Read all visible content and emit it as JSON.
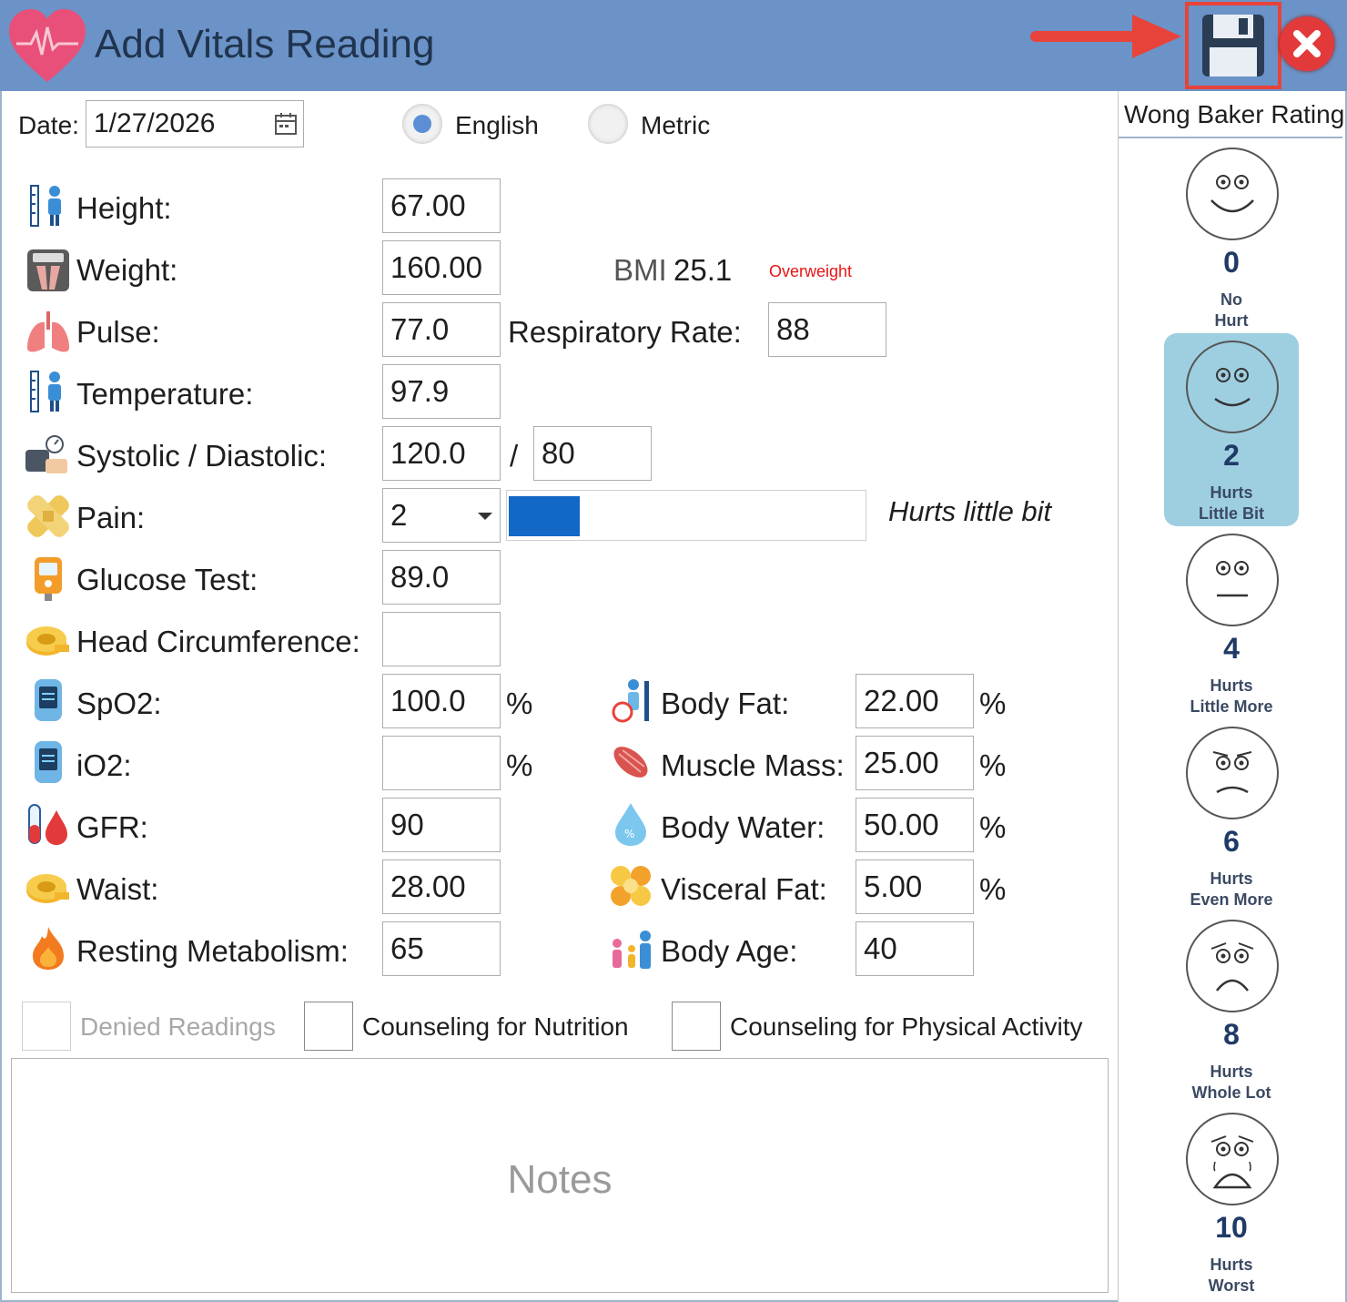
{
  "window": {
    "title": "Add Vitals Reading"
  },
  "date": {
    "label": "Date:",
    "value": "1/27/2026"
  },
  "units": {
    "english_label": "English",
    "metric_label": "Metric",
    "selected": "English"
  },
  "vitals": {
    "height": {
      "label": "Height:",
      "value": "67.00"
    },
    "weight": {
      "label": "Weight:",
      "value": "160.00"
    },
    "bmi": {
      "label": "BMI",
      "value": "25.1",
      "status": "Overweight",
      "status_color": "#e81515"
    },
    "pulse": {
      "label": "Pulse:",
      "value": "77.0"
    },
    "respiratory_rate": {
      "label": "Respiratory Rate:",
      "value": "88"
    },
    "temperature": {
      "label": "Temperature:",
      "value": "97.9"
    },
    "blood_pressure": {
      "label": "Systolic / Diastolic:",
      "systolic": "120.0",
      "separator": "/",
      "diastolic": "80"
    },
    "pain": {
      "label": "Pain:",
      "value": "2",
      "max": 10,
      "description": "Hurts little bit",
      "bar_color": "#1168c6"
    },
    "glucose": {
      "label": "Glucose Test:",
      "value": "89.0"
    },
    "head_circumference": {
      "label": "Head Circumference:",
      "value": ""
    },
    "spo2": {
      "label": "SpO2:",
      "value": "100.0",
      "unit": "%"
    },
    "io2": {
      "label": "iO2:",
      "value": "",
      "unit": "%"
    },
    "gfr": {
      "label": "GFR:",
      "value": "90"
    },
    "waist": {
      "label": "Waist:",
      "value": "28.00"
    },
    "resting_metabolism": {
      "label": "Resting Metabolism:",
      "value": "65"
    },
    "body_fat": {
      "label": "Body Fat:",
      "value": "22.00",
      "unit": "%"
    },
    "muscle_mass": {
      "label": "Muscle Mass:",
      "value": "25.00",
      "unit": "%"
    },
    "body_water": {
      "label": "Body Water:",
      "value": "50.00",
      "unit": "%"
    },
    "visceral_fat": {
      "label": "Visceral Fat:",
      "value": "5.00",
      "unit": "%"
    },
    "body_age": {
      "label": "Body Age:",
      "value": "40"
    }
  },
  "checkboxes": {
    "denied_readings": "Denied Readings",
    "counseling_nutrition": "Counseling for Nutrition",
    "counseling_activity": "Counseling for Physical Activity"
  },
  "notes": {
    "placeholder": "Notes"
  },
  "wong_baker": {
    "title": "Wong Baker Rating",
    "selected": "2",
    "faces": [
      {
        "num": "0",
        "desc": "No\nHurt"
      },
      {
        "num": "2",
        "desc": "Hurts\nLittle Bit"
      },
      {
        "num": "4",
        "desc": "Hurts\nLittle More"
      },
      {
        "num": "6",
        "desc": "Hurts\nEven More"
      },
      {
        "num": "8",
        "desc": "Hurts\nWhole Lot"
      },
      {
        "num": "10",
        "desc": "Hurts\nWorst"
      }
    ]
  },
  "icons": {
    "app": "heart-monitor-icon",
    "save": "floppy-disk-icon",
    "close": "close-icon",
    "calendar": "calendar-icon",
    "dropdown": "chevron-down-icon"
  },
  "colors": {
    "titlebar": "#6b93c7",
    "accent": "#5b8ed4",
    "highlight": "#e8433b"
  }
}
